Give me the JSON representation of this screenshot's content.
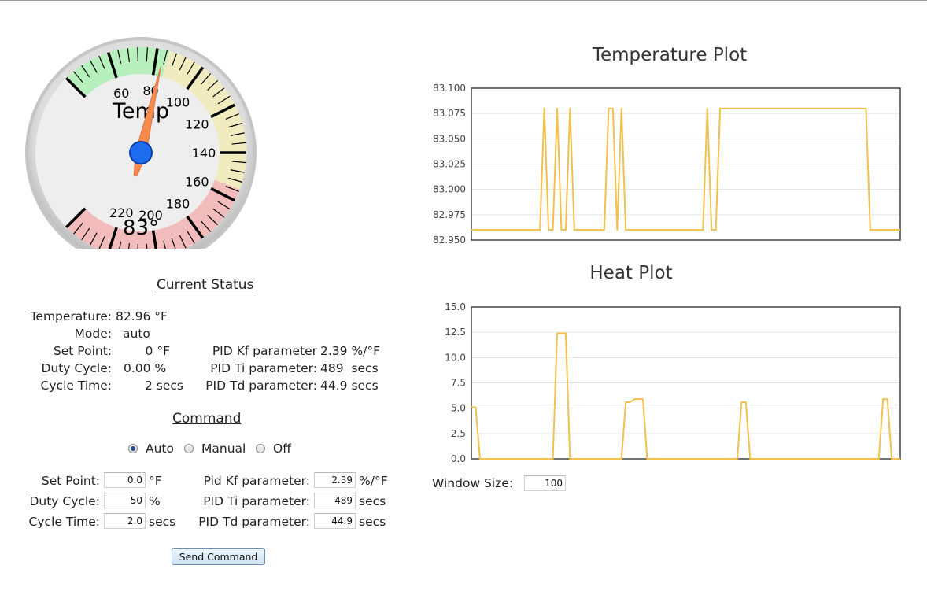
{
  "gauge": {
    "title": "Temp",
    "value": 83,
    "value_label": "83°",
    "min": 40,
    "max": 240,
    "ticks": [
      "60",
      "80",
      "100",
      "120",
      "140",
      "160",
      "180",
      "200",
      "220"
    ],
    "green_range": [
      40,
      85
    ],
    "yellow_range": [
      85,
      155
    ],
    "red_range": [
      155,
      240
    ],
    "colors": {
      "green": "#b7f0bc",
      "yellow": "#f0ecbf",
      "red": "#f2bcbc",
      "needle": "#f78b4c",
      "hub": "#1d6cf0"
    }
  },
  "status": {
    "heading": "Current Status",
    "temperature_label": "Temperature:",
    "temperature_value": "82.96 °F",
    "mode_label": "Mode:",
    "mode_value": "auto",
    "setpoint_label": "Set Point:",
    "setpoint_value": "0 °F",
    "duty_label": "Duty Cycle:",
    "duty_value": "0.00 %",
    "cycle_label": "Cycle Time:",
    "cycle_value": "2 secs",
    "kf_label": "PID Kf parameter",
    "kf_value": "2.39 %/°F",
    "ti_label": "PID Ti parameter:",
    "ti_value": "489  secs",
    "td_label": "PID Td parameter:",
    "td_value": "44.9 secs"
  },
  "command": {
    "heading": "Command",
    "modes": [
      "Auto",
      "Manual",
      "Off"
    ],
    "selected_mode": "Auto",
    "setpoint_label": "Set Point:",
    "setpoint_value": "0.0",
    "setpoint_unit": "°F",
    "duty_label": "Duty Cycle:",
    "duty_value": "50",
    "duty_unit": "%",
    "cycle_label": "Cycle Time:",
    "cycle_value": "2.0",
    "cycle_unit": "secs",
    "kf_label": "Pid Kf parameter:",
    "kf_value": "2.39",
    "kf_unit": "%/°F",
    "ti_label": "PID Ti parameter:",
    "ti_value": "489",
    "ti_unit": "secs",
    "td_label": "PID Td parameter:",
    "td_value": "44.9",
    "td_unit": "secs",
    "send_label": "Send Command"
  },
  "window": {
    "label": "Window Size:",
    "value": "100"
  },
  "chart_data": [
    {
      "type": "line",
      "title": "Temperature Plot",
      "ylim": [
        82.95,
        83.1
      ],
      "yticks": [
        "82.950",
        "82.975",
        "83.000",
        "83.025",
        "83.050",
        "83.075",
        "83.100"
      ],
      "x": [
        0,
        16,
        17,
        18,
        19,
        20,
        21,
        22,
        23,
        24,
        25,
        31,
        32,
        33,
        34,
        35,
        36,
        54,
        55,
        56,
        57,
        58,
        92,
        93,
        100
      ],
      "series": [
        {
          "color": "#f0c24d",
          "values": [
            82.96,
            82.96,
            83.08,
            82.96,
            82.96,
            83.08,
            82.96,
            82.96,
            83.08,
            82.96,
            82.96,
            82.96,
            83.08,
            83.08,
            82.96,
            83.08,
            82.96,
            82.96,
            83.08,
            82.96,
            82.96,
            83.08,
            83.08,
            82.96,
            82.96
          ]
        }
      ],
      "grid": true
    },
    {
      "type": "line",
      "title": "Heat Plot",
      "ylim": [
        0,
        15
      ],
      "yticks": [
        "0.0",
        "2.5",
        "5.0",
        "7.5",
        "10.0",
        "12.5",
        "15.0"
      ],
      "x": [
        0,
        1,
        2,
        19,
        20,
        22,
        23,
        35,
        36,
        37,
        38,
        40,
        41,
        62,
        63,
        64,
        65,
        95,
        96,
        97,
        98,
        100
      ],
      "series": [
        {
          "color": "#f0c24d",
          "values": [
            5.1,
            5.1,
            0,
            0,
            12.4,
            12.4,
            0,
            0,
            5.6,
            5.6,
            5.9,
            5.9,
            0,
            0,
            5.6,
            5.6,
            0,
            0,
            5.9,
            5.9,
            0,
            0
          ]
        }
      ],
      "grid": true
    }
  ]
}
